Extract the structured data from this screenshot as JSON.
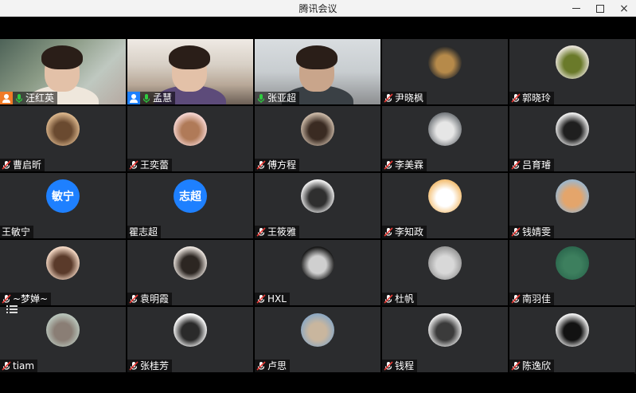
{
  "window": {
    "title": "腾讯会议",
    "controls": {
      "minimize": "minimize-icon",
      "maximize": "maximize-icon",
      "close": "×"
    }
  },
  "participants": [
    {
      "name": "汪红英",
      "type": "video",
      "host": true,
      "host_color": "#f07b27",
      "mic": "on"
    },
    {
      "name": "孟慧",
      "type": "video",
      "host": true,
      "host_color": "#1e80ff",
      "mic": "on"
    },
    {
      "name": "张亚超",
      "type": "video",
      "host": false,
      "mic": "on"
    },
    {
      "name": "尹晓枫",
      "type": "photo",
      "mic": "muted",
      "photo_colors": [
        "#2b2b2b",
        "#b68a4a"
      ]
    },
    {
      "name": "郭晓玲",
      "type": "photo",
      "mic": "muted",
      "photo_colors": [
        "#e9e4d8",
        "#6a7a2a"
      ]
    },
    {
      "name": "曹启昕",
      "type": "photo",
      "mic": "muted",
      "photo_colors": [
        "#d9b48a",
        "#6a4a30"
      ]
    },
    {
      "name": "王奕蕾",
      "type": "photo",
      "mic": "muted",
      "photo_colors": [
        "#f5d4cf",
        "#b07a58"
      ]
    },
    {
      "name": "傅方程",
      "type": "photo",
      "mic": "muted",
      "photo_colors": [
        "#c9b7a5",
        "#3a2b22"
      ]
    },
    {
      "name": "李美霖",
      "type": "photo",
      "mic": "muted",
      "photo_colors": [
        "#7a7e82",
        "#e6e6e6"
      ]
    },
    {
      "name": "吕育璿",
      "type": "photo",
      "mic": "muted",
      "photo_colors": [
        "#eeeeee",
        "#1f1f1f"
      ]
    },
    {
      "name": "王敏宁",
      "type": "text",
      "avatar_text": "敏宁",
      "mic": "none"
    },
    {
      "name": "瞿志超",
      "type": "text",
      "avatar_text": "志超",
      "mic": "none"
    },
    {
      "name": "王筱雅",
      "type": "photo",
      "mic": "muted",
      "photo_colors": [
        "#f0f0f0",
        "#2f2f2f"
      ]
    },
    {
      "name": "李知政",
      "type": "photo",
      "mic": "muted",
      "photo_colors": [
        "#f4c27a",
        "#ffffff"
      ]
    },
    {
      "name": "钱婧雯",
      "type": "photo",
      "mic": "muted",
      "photo_colors": [
        "#9fb6c9",
        "#e4a56b"
      ]
    },
    {
      "name": "~梦婵~",
      "type": "photo",
      "mic": "muted",
      "photo_colors": [
        "#f4d8c4",
        "#5a3a2a"
      ]
    },
    {
      "name": "袁明霞",
      "type": "photo",
      "mic": "muted",
      "photo_colors": [
        "#ece5df",
        "#2c2622"
      ]
    },
    {
      "name": "HXL",
      "type": "photo",
      "mic": "muted",
      "photo_colors": [
        "#1a1a1a",
        "#cfcfcf"
      ]
    },
    {
      "name": "杜帆",
      "type": "photo",
      "mic": "muted",
      "photo_colors": [
        "#9a9a9a",
        "#d8d8d8"
      ]
    },
    {
      "name": "南羽佳",
      "type": "photo",
      "mic": "muted",
      "photo_colors": [
        "#2d6a4f",
        "#3d7f5e"
      ]
    },
    {
      "name": "tiam",
      "type": "photo",
      "mic": "muted",
      "photo_colors": [
        "#b8c4ba",
        "#8a7e75"
      ]
    },
    {
      "name": "张桂芳",
      "type": "photo",
      "mic": "muted",
      "photo_colors": [
        "#ffffff",
        "#2a2a2a"
      ]
    },
    {
      "name": "卢思",
      "type": "photo",
      "mic": "muted",
      "photo_colors": [
        "#8fa9c2",
        "#c9b69e"
      ]
    },
    {
      "name": "钱程",
      "type": "photo",
      "mic": "muted",
      "photo_colors": [
        "#eaeaea",
        "#3b3b3b"
      ]
    },
    {
      "name": "陈逸欣",
      "type": "photo",
      "mic": "muted",
      "photo_colors": [
        "#f2f2f2",
        "#121212"
      ]
    }
  ],
  "icons": {
    "mic_on": "mic-on-icon",
    "mic_muted": "mic-muted-icon",
    "host": "host-icon",
    "member_list": "list-icon"
  },
  "colors": {
    "tile_bg": "#2b2c2e",
    "accent_blue": "#1e80ff",
    "host_orange": "#f07b27"
  }
}
